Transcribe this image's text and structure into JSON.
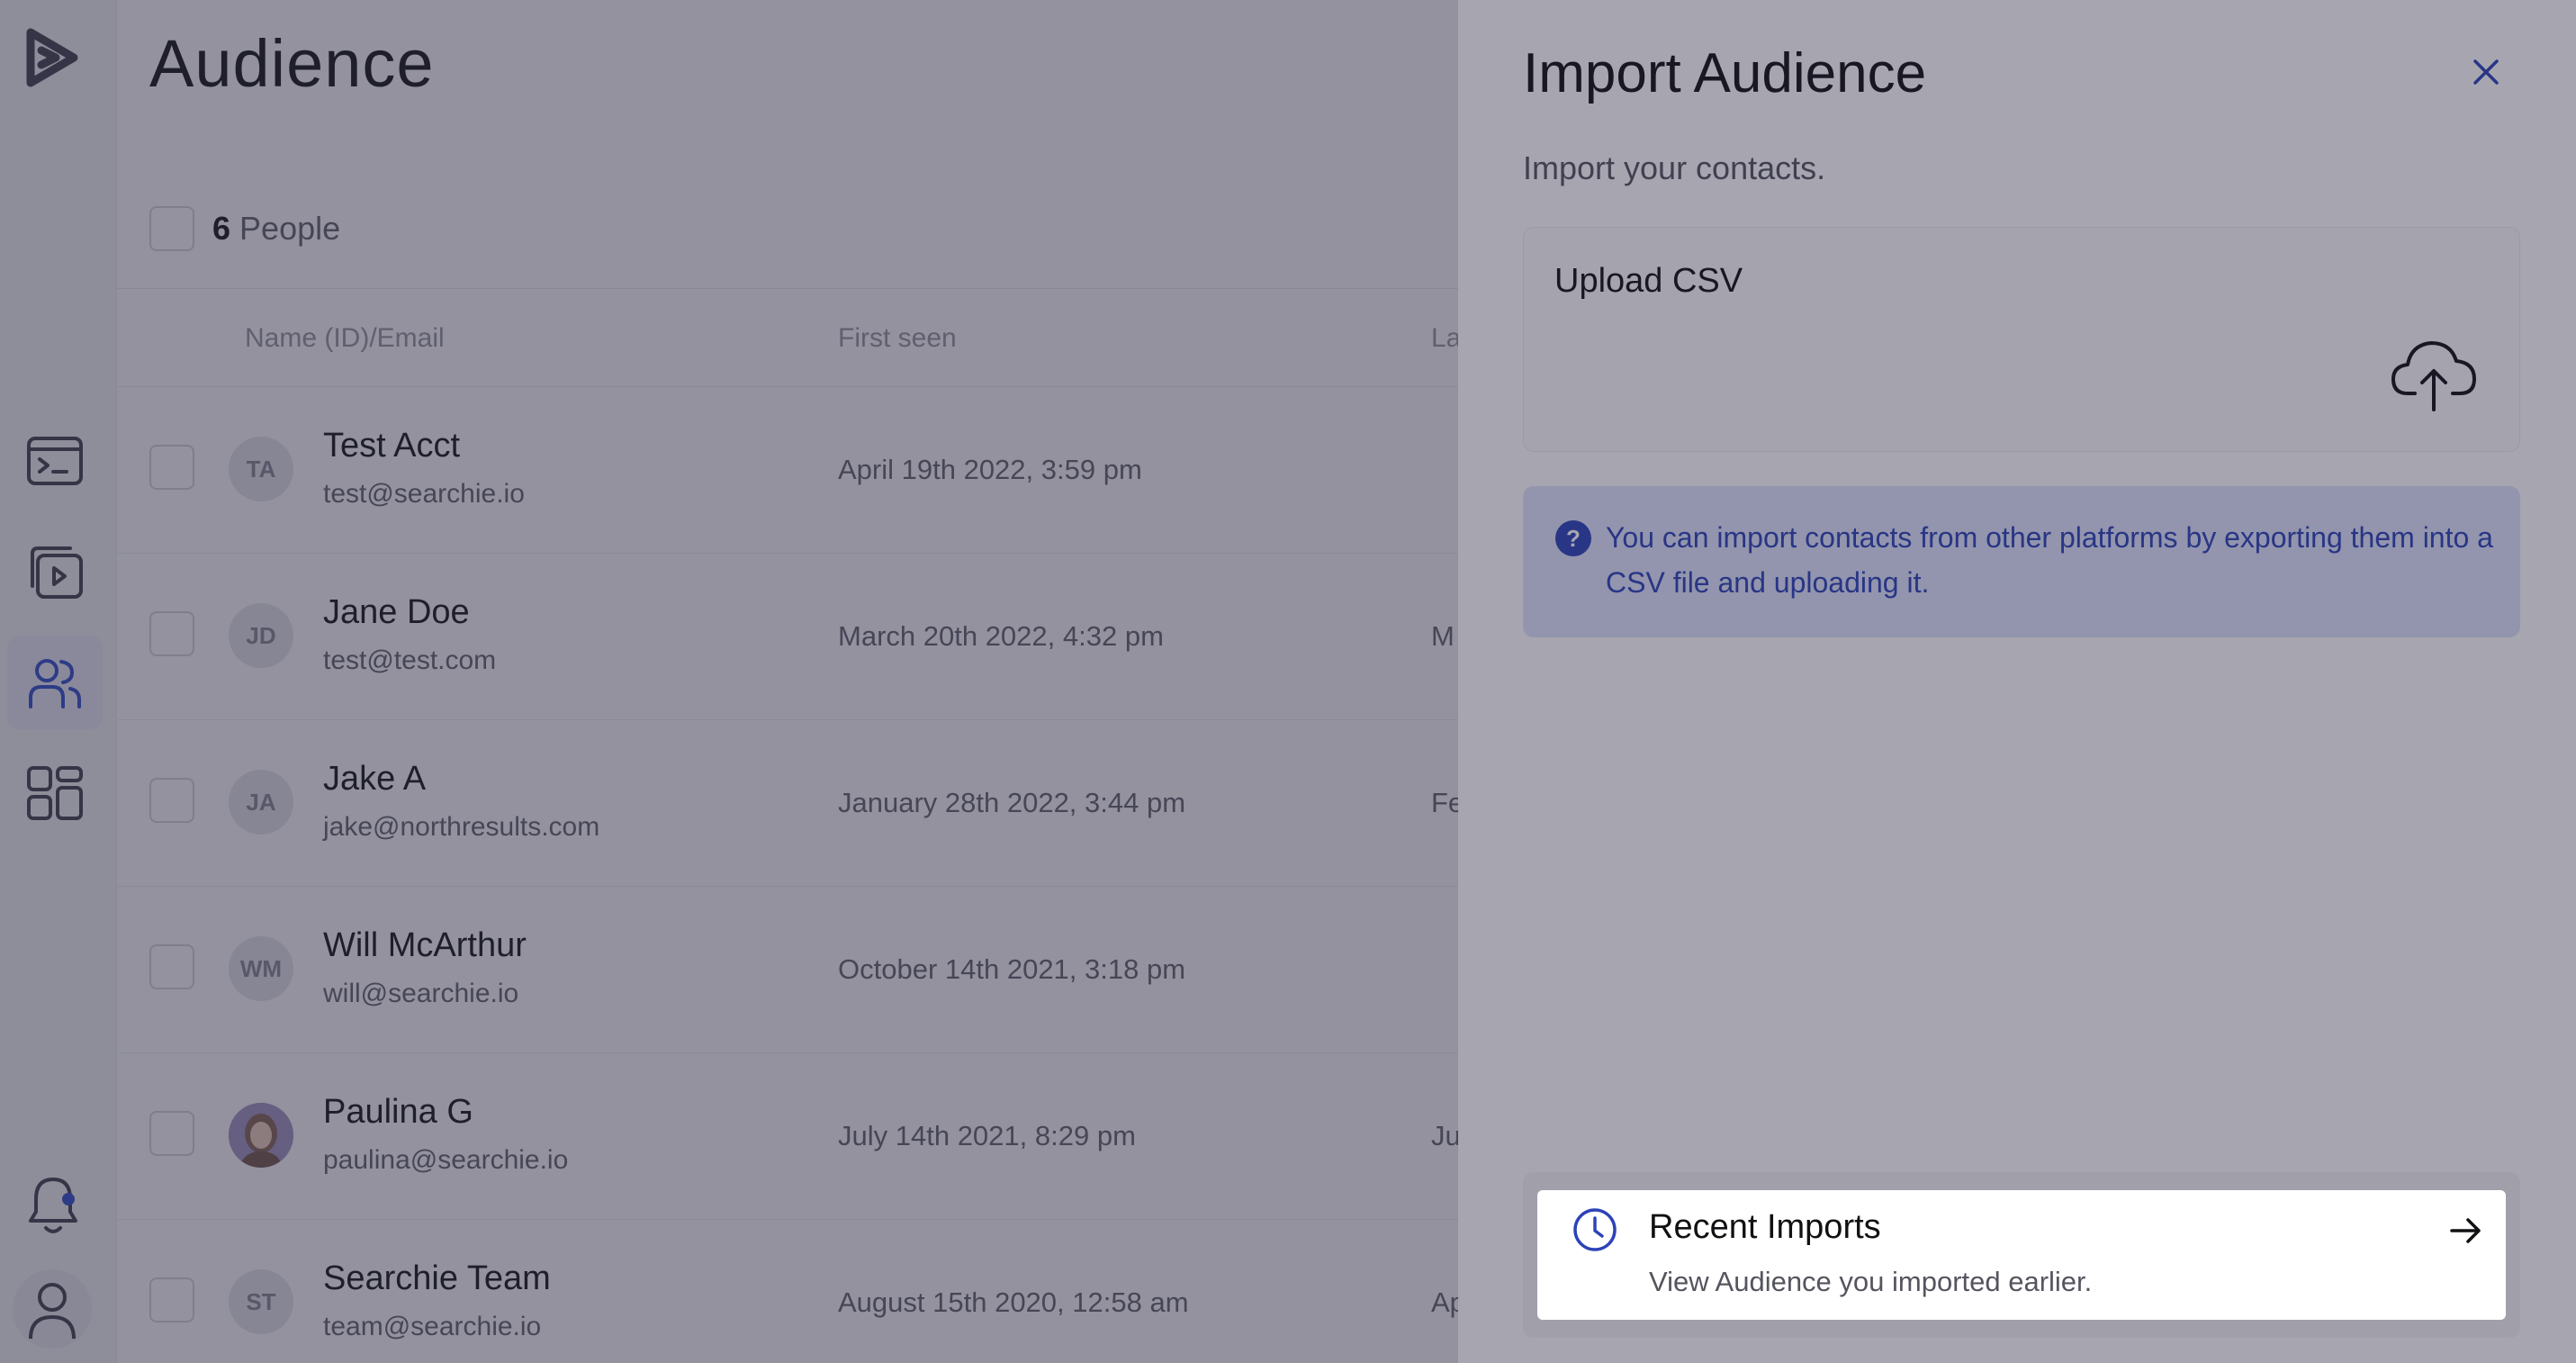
{
  "page": {
    "title": "Audience"
  },
  "list": {
    "count": "6",
    "count_label": "People",
    "columns": [
      "Name (ID)/Email",
      "First seen",
      "La"
    ],
    "rows": [
      {
        "initials": "TA",
        "name": "Test Acct",
        "email": "test@searchie.io",
        "first_seen": "April 19th 2022, 3:59 pm",
        "last_seen": ""
      },
      {
        "initials": "JD",
        "name": "Jane Doe",
        "email": "test@test.com",
        "first_seen": "March 20th 2022, 4:32 pm",
        "last_seen": "M"
      },
      {
        "initials": "JA",
        "name": "Jake A",
        "email": "jake@northresults.com",
        "first_seen": "January 28th 2022, 3:44 pm",
        "last_seen": "Fe"
      },
      {
        "initials": "WM",
        "name": "Will McArthur",
        "email": "will@searchie.io",
        "first_seen": "October 14th 2021, 3:18 pm",
        "last_seen": ""
      },
      {
        "initials": "",
        "name": "Paulina G",
        "email": "paulina@searchie.io",
        "first_seen": "July 14th 2021, 8:29 pm",
        "last_seen": "Ju"
      },
      {
        "initials": "ST",
        "name": "Searchie Team",
        "email": "team@searchie.io",
        "first_seen": "August 15th 2020, 12:58 am",
        "last_seen": "Ap"
      }
    ]
  },
  "drawer": {
    "title": "Import Audience",
    "subtitle": "Import your contacts.",
    "upload_label": "Upload CSV",
    "info_text": "You can import contacts from other platforms by exporting them into a CSV file and uploading it.",
    "recent_title": "Recent Imports",
    "recent_desc": "View Audience you imported earlier."
  },
  "icons": {
    "logo": "play-logo-icon",
    "nav": [
      "terminal-window-icon",
      "video-library-icon",
      "users-icon",
      "apps-grid-icon"
    ],
    "bell": "bell-icon",
    "avatar": "user-icon",
    "close": "close-icon",
    "upload": "cloud-upload-icon",
    "info": "question-icon",
    "clock": "clock-icon",
    "arrow": "arrow-right-icon"
  },
  "colors": {
    "accent": "#2d43b8",
    "info_background": "#dde3fb",
    "overlay": "#22203a"
  }
}
